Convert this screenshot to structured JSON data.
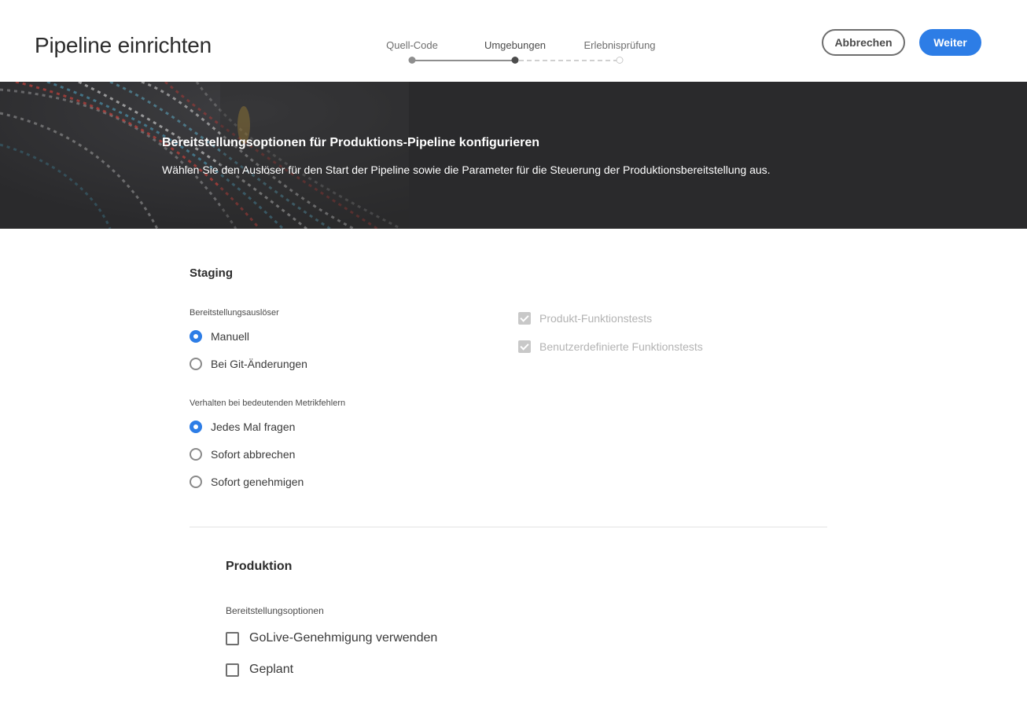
{
  "header": {
    "title": "Pipeline einrichten",
    "steps": [
      {
        "label": "Quell-Code",
        "state": "done"
      },
      {
        "label": "Umgebungen",
        "state": "current"
      },
      {
        "label": "Erlebnisprüfung",
        "state": "todo"
      }
    ],
    "cancel_label": "Abbrechen",
    "next_label": "Weiter"
  },
  "banner": {
    "title": "Bereitstellungsoptionen für Produktions-Pipeline konfigurieren",
    "description": "Wählen Sie den Auslöser für den Start der Pipeline sowie die Parameter für die Steuerung der Produktionsbereitstellung aus."
  },
  "staging": {
    "title": "Staging",
    "trigger_label": "Bereitstellungsauslöser",
    "trigger_options": [
      {
        "label": "Manuell",
        "checked": true
      },
      {
        "label": "Bei Git-Änderungen",
        "checked": false
      }
    ],
    "metric_label": "Verhalten bei bedeutenden Metrikfehlern",
    "metric_options": [
      {
        "label": "Jedes Mal fragen",
        "checked": true
      },
      {
        "label": "Sofort abbrechen",
        "checked": false
      },
      {
        "label": "Sofort genehmigen",
        "checked": false
      }
    ],
    "tests": [
      {
        "label": "Produkt-Funktionstests",
        "checked": true,
        "disabled": true
      },
      {
        "label": "Benutzerdefinierte Funktionstests",
        "checked": true,
        "disabled": true
      }
    ]
  },
  "production": {
    "title": "Produktion",
    "options_label": "Bereitstellungsoptionen",
    "options": [
      {
        "label": "GoLive-Genehmigung verwenden",
        "checked": false
      },
      {
        "label": "Geplant",
        "checked": false
      }
    ]
  },
  "colors": {
    "accent": "#2d7de6",
    "banner_bg": "#2a2a2c"
  }
}
